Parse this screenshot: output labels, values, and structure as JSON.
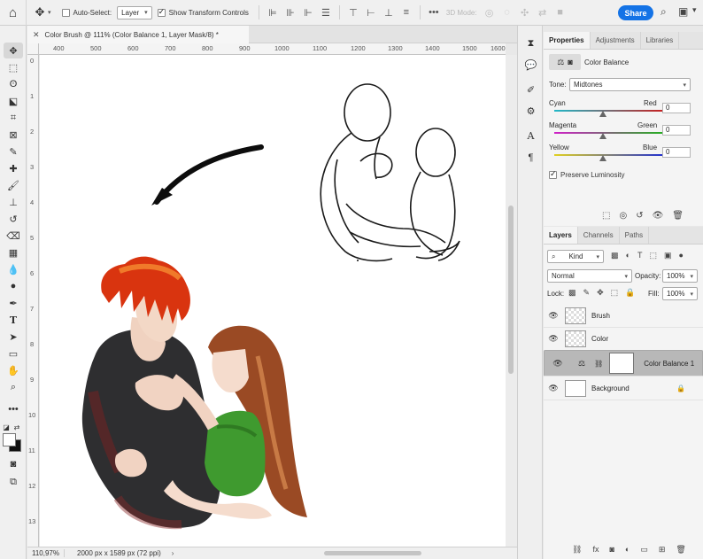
{
  "options_bar": {
    "auto_select_label": "Auto-Select:",
    "auto_select_value": "Layer",
    "show_transform_label": "Show Transform Controls",
    "mode3d_label": "3D Mode:",
    "share_label": "Share"
  },
  "document_tab": {
    "title": "Color Brush @ 111% (Color Balance 1, Layer Mask/8) *"
  },
  "rulers": {
    "horizontal": [
      "400",
      "500",
      "600",
      "700",
      "800",
      "900",
      "1000",
      "1100",
      "1200",
      "1300",
      "1400",
      "1500",
      "1600"
    ],
    "vertical": [
      "0",
      "1",
      "2",
      "3",
      "4",
      "5",
      "6",
      "7",
      "8",
      "9",
      "10",
      "11",
      "12",
      "13"
    ]
  },
  "status_bar": {
    "zoom": "110,97%",
    "dimensions": "2000 px x 1589 px (72 ppi)",
    "more": "›"
  },
  "properties_panel": {
    "tabs": [
      "Properties",
      "Adjustments",
      "Libraries"
    ],
    "active_tab": "Properties",
    "adjustment_name": "Color Balance",
    "tone_label": "Tone:",
    "tone_value": "Midtones",
    "sliders": [
      {
        "left": "Cyan",
        "right": "Red",
        "value": "0",
        "level": 0
      },
      {
        "left": "Magenta",
        "right": "Green",
        "value": "0",
        "level": 0
      },
      {
        "left": "Yellow",
        "right": "Blue",
        "value": "0",
        "level": 0
      }
    ],
    "preserve_luminosity_label": "Preserve Luminosity",
    "preserve_luminosity_checked": true
  },
  "layers_panel": {
    "tabs": [
      "Layers",
      "Channels",
      "Paths"
    ],
    "active_tab": "Layers",
    "filter_value": "Kind",
    "blend_mode": "Normal",
    "opacity_label": "Opacity:",
    "opacity_value": "100%",
    "lock_label": "Lock:",
    "fill_label": "Fill:",
    "fill_value": "100%",
    "layers": [
      {
        "name": "Brush",
        "type": "pixel-transparent",
        "visible": true,
        "selected": false
      },
      {
        "name": "Color",
        "type": "pixel-transparent",
        "visible": true,
        "selected": false
      },
      {
        "name": "Color Balance 1",
        "type": "adjustment",
        "visible": true,
        "selected": true
      },
      {
        "name": "Background",
        "type": "background",
        "visible": true,
        "selected": false,
        "locked": true
      }
    ]
  },
  "colors": {
    "accent": "#1473e6",
    "selected_layer": "#b8b8b8",
    "foreground_swatch": "#ffffff",
    "background_swatch": "#111111"
  }
}
